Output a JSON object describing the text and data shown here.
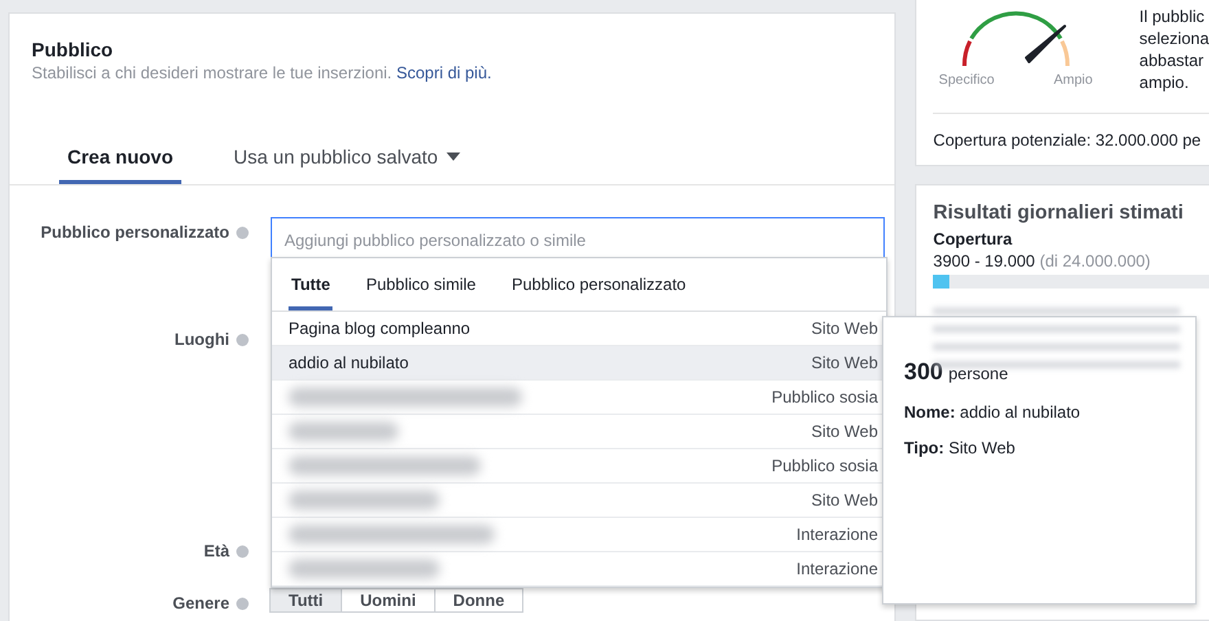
{
  "audience": {
    "title": "Pubblico",
    "description": "Stabilisci a chi desideri mostrare le tue inserzioni.",
    "link": "Scopri di più."
  },
  "tabs": [
    {
      "label": "Crea nuovo",
      "selected": true,
      "dropdown": false
    },
    {
      "label": "Usa un pubblico salvato",
      "selected": false,
      "dropdown": true
    }
  ],
  "form": {
    "custom_audience": {
      "label": "Pubblico personalizzato",
      "placeholder": "Aggiungi pubblico personalizzato o simile"
    },
    "labels": [
      {
        "label": "Luoghi"
      },
      {
        "label": "Età"
      }
    ],
    "gender": {
      "label": "Genere",
      "options": [
        {
          "label": "Tutti",
          "selected": true
        },
        {
          "label": "Uomini",
          "selected": false
        },
        {
          "label": "Donne",
          "selected": false
        }
      ]
    }
  },
  "dropdown": {
    "tabs": [
      {
        "label": "Tutte",
        "selected": true
      },
      {
        "label": "Pubblico simile",
        "selected": false
      },
      {
        "label": "Pubblico personalizzato",
        "selected": false
      }
    ],
    "items": [
      {
        "kind": "named",
        "name": "Pagina blog compleanno",
        "type": "Sito Web",
        "highlighted": false
      },
      {
        "kind": "named",
        "name": "addio al nubilato",
        "type": "Sito Web",
        "highlighted": true
      },
      {
        "kind": "blurred",
        "type": "Pubblico sosia",
        "highlighted": false
      },
      {
        "kind": "blurred",
        "type": "Sito Web",
        "highlighted": false
      },
      {
        "kind": "blurred",
        "type": "Pubblico sosia",
        "highlighted": false
      },
      {
        "kind": "blurred",
        "type": "Sito Web",
        "highlighted": false
      },
      {
        "kind": "blurred",
        "type": "Interazione",
        "highlighted": false
      },
      {
        "kind": "blurred",
        "type": "Interazione",
        "highlighted": false
      }
    ]
  },
  "tooltip": {
    "count": "300",
    "unit": "persone",
    "name_label": "Nome:",
    "name": "addio al nubilato",
    "type_label": "Tipo:",
    "type": "Sito Web"
  },
  "audience_size": {
    "gauge_min": "Specifico",
    "gauge_max": "Ampio",
    "text_lines": [
      "Il pubblic",
      "seleziona",
      "abbastar",
      "ampio."
    ],
    "potential_reach": "Copertura potenziale: 32.000.000 pe"
  },
  "daily_results": {
    "title": "Risultati giornalieri stimati",
    "metric": "Copertura",
    "range": "3900 - 19.000",
    "total": "(di 24.000.000)",
    "level": 0.06
  }
}
